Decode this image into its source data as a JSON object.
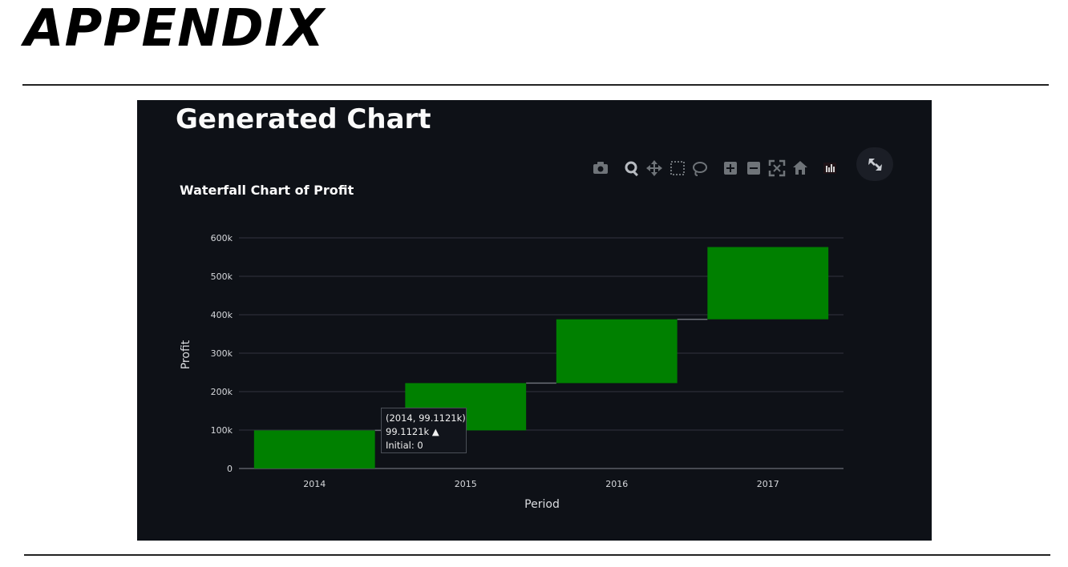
{
  "page": {
    "heading": "APPENDIX"
  },
  "panel": {
    "title": "Generated Chart"
  },
  "modebar": {
    "icons": [
      "camera-icon",
      "zoom-icon",
      "pan-icon",
      "box-select-icon",
      "lasso-icon",
      "zoom-in-icon",
      "zoom-out-icon",
      "autoscale-icon",
      "reset-axes-icon",
      "plotly-logo-icon"
    ],
    "expand_icon": "expand-icon"
  },
  "chart_data": {
    "type": "waterfall",
    "title": "Waterfall Chart of Profit",
    "xlabel": "Period",
    "ylabel": "Profit",
    "categories": [
      "2014",
      "2015",
      "2016",
      "2017"
    ],
    "values": [
      99112.1,
      123000,
      166000,
      188000
    ],
    "measure": [
      "relative",
      "relative",
      "relative",
      "relative"
    ],
    "ylim": [
      0,
      600000
    ],
    "yticks": [
      0,
      100000,
      200000,
      300000,
      400000,
      500000,
      600000
    ],
    "ytick_labels": [
      "0",
      "100k",
      "200k",
      "300k",
      "400k",
      "500k",
      "600k"
    ],
    "bar_color": "#008000",
    "connector_color": "#6b6f77",
    "grid": true,
    "background": "#0e1117",
    "gridline_color": "#31333f"
  },
  "tooltip": {
    "line1": "(2014, 99.1121k)",
    "line2": "99.1121k ▲",
    "line3": "Initial: 0"
  }
}
